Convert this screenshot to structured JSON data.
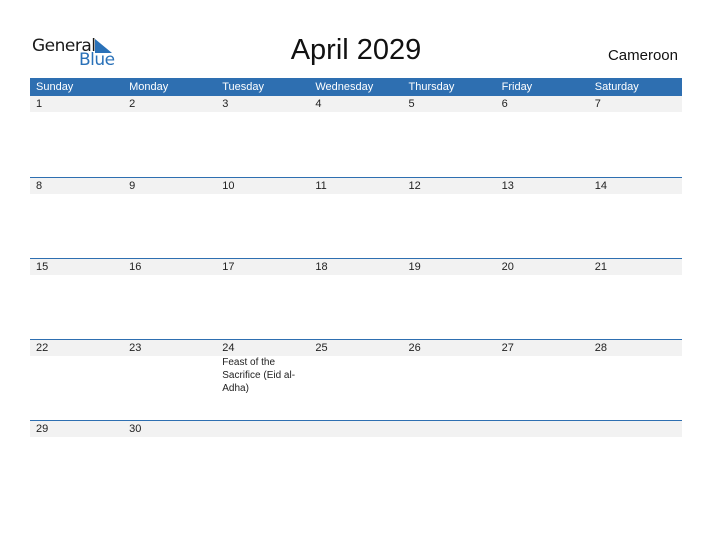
{
  "logo": {
    "general": "General",
    "blue": "Blue"
  },
  "title": "April 2029",
  "country": "Cameroon",
  "colors": {
    "accent": "#2e6fb1",
    "daybar": "#f2f2f2"
  },
  "weekdays": [
    "Sunday",
    "Monday",
    "Tuesday",
    "Wednesday",
    "Thursday",
    "Friday",
    "Saturday"
  ],
  "weeks": [
    {
      "days": [
        "1",
        "2",
        "3",
        "4",
        "5",
        "6",
        "7"
      ],
      "events": [
        "",
        "",
        "",
        "",
        "",
        "",
        ""
      ]
    },
    {
      "days": [
        "8",
        "9",
        "10",
        "11",
        "12",
        "13",
        "14"
      ],
      "events": [
        "",
        "",
        "",
        "",
        "",
        "",
        ""
      ]
    },
    {
      "days": [
        "15",
        "16",
        "17",
        "18",
        "19",
        "20",
        "21"
      ],
      "events": [
        "",
        "",
        "",
        "",
        "",
        "",
        ""
      ]
    },
    {
      "days": [
        "22",
        "23",
        "24",
        "25",
        "26",
        "27",
        "28"
      ],
      "events": [
        "",
        "",
        "Feast of the Sacrifice (Eid al-Adha)",
        "",
        "",
        "",
        ""
      ]
    },
    {
      "days": [
        "29",
        "30",
        "",
        "",
        "",
        "",
        ""
      ],
      "events": [
        "",
        "",
        "",
        "",
        "",
        "",
        ""
      ]
    }
  ]
}
